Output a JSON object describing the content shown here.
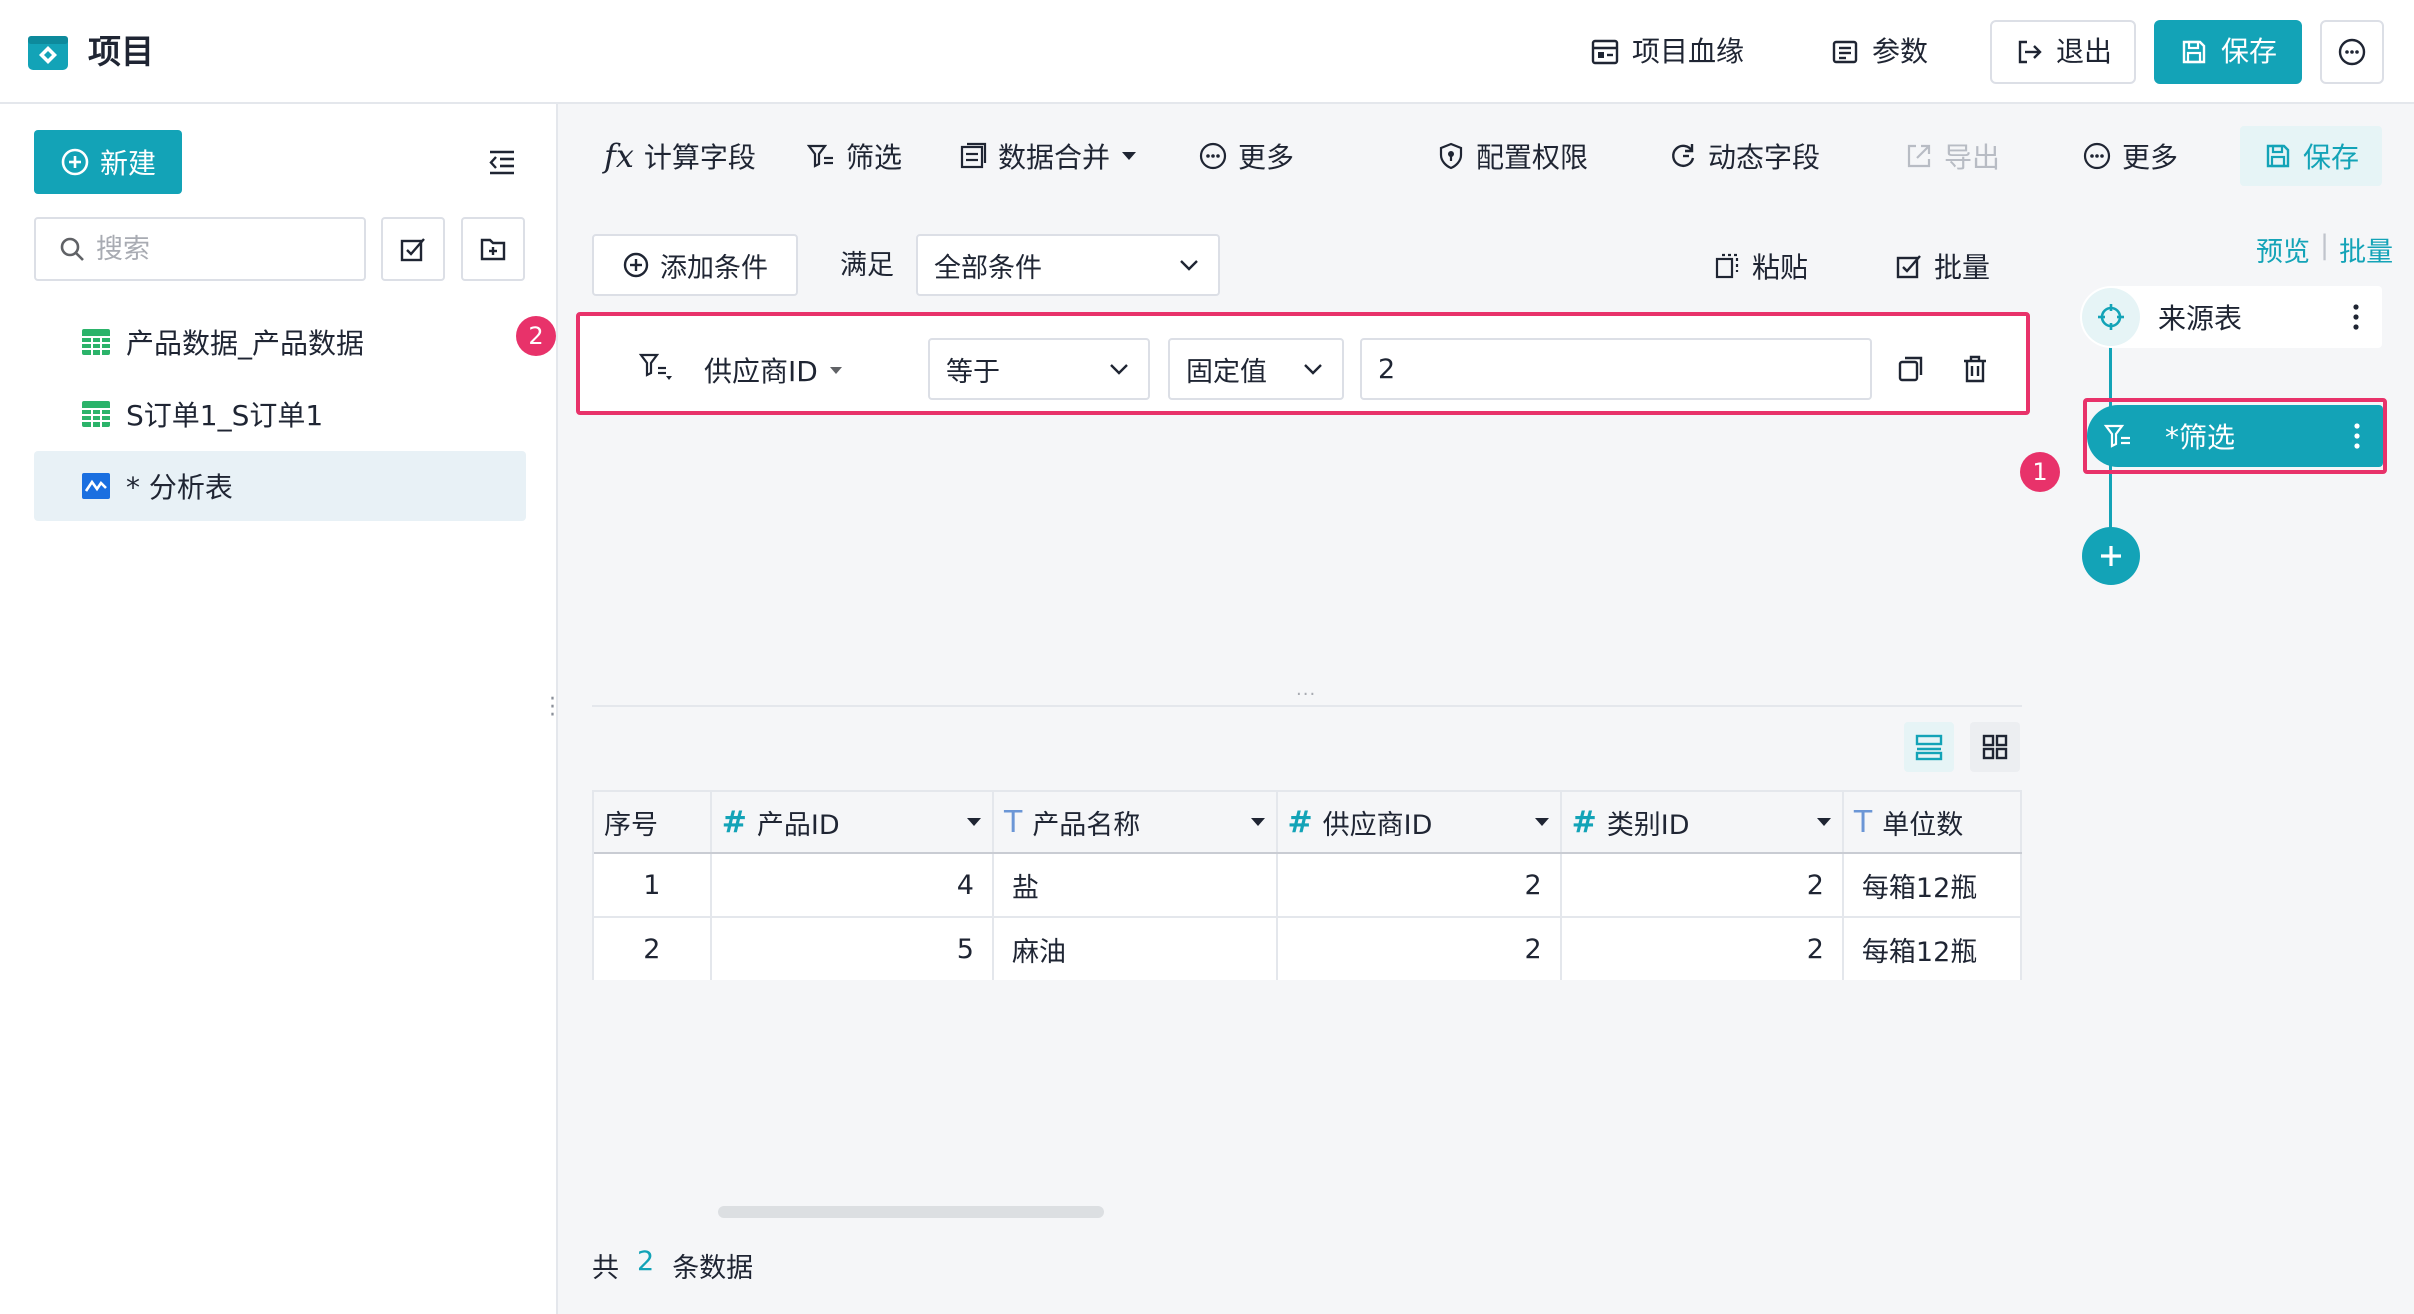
{
  "header": {
    "title": "项目",
    "lineage_label": "项目血缘",
    "params_label": "参数",
    "exit_label": "退出",
    "save_label": "保存"
  },
  "sidebar": {
    "new_label": "新建",
    "search_placeholder": "搜索",
    "items": [
      {
        "label": "产品数据_产品数据",
        "icon": "table-icon"
      },
      {
        "label": "S订单1_S订单1",
        "icon": "table-icon"
      },
      {
        "label": "* 分析表",
        "icon": "analysis-icon",
        "active": true
      }
    ]
  },
  "toolbar": {
    "fx_glyph": "fx",
    "calc_field": "计算字段",
    "filter": "筛选",
    "merge": "数据合并",
    "more1": "更多",
    "permission": "配置权限",
    "dynamic_field": "动态字段",
    "export": "导出",
    "more2": "更多",
    "save": "保存"
  },
  "filter_panel": {
    "add_condition": "添加条件",
    "satisfy_label": "满足",
    "satisfy_value": "全部条件",
    "paste_label": "粘贴",
    "batch_label": "批量",
    "badge": "2",
    "condition": {
      "field": "供应商ID",
      "operator": "等于",
      "value_type": "固定值",
      "value": "2"
    }
  },
  "table": {
    "columns": [
      {
        "label": "序号",
        "type": ""
      },
      {
        "label": "产品ID",
        "type": "#"
      },
      {
        "label": "产品名称",
        "type": "T"
      },
      {
        "label": "供应商ID",
        "type": "#"
      },
      {
        "label": "类别ID",
        "type": "#"
      },
      {
        "label": "单位数",
        "type": "T"
      }
    ],
    "rows": [
      [
        "1",
        "4",
        "盐",
        "2",
        "2",
        "每箱12瓶"
      ],
      [
        "2",
        "5",
        "麻油",
        "2",
        "2",
        "每箱12瓶"
      ]
    ],
    "footer_prefix": "共",
    "footer_count": "2",
    "footer_suffix": "条数据"
  },
  "flow": {
    "preview_label": "预览",
    "batch_label": "批量",
    "source_node": "来源表",
    "filter_node": "*筛选",
    "badge": "1"
  },
  "colors": {
    "accent": "#13a3b7",
    "highlight": "#e8326a"
  }
}
